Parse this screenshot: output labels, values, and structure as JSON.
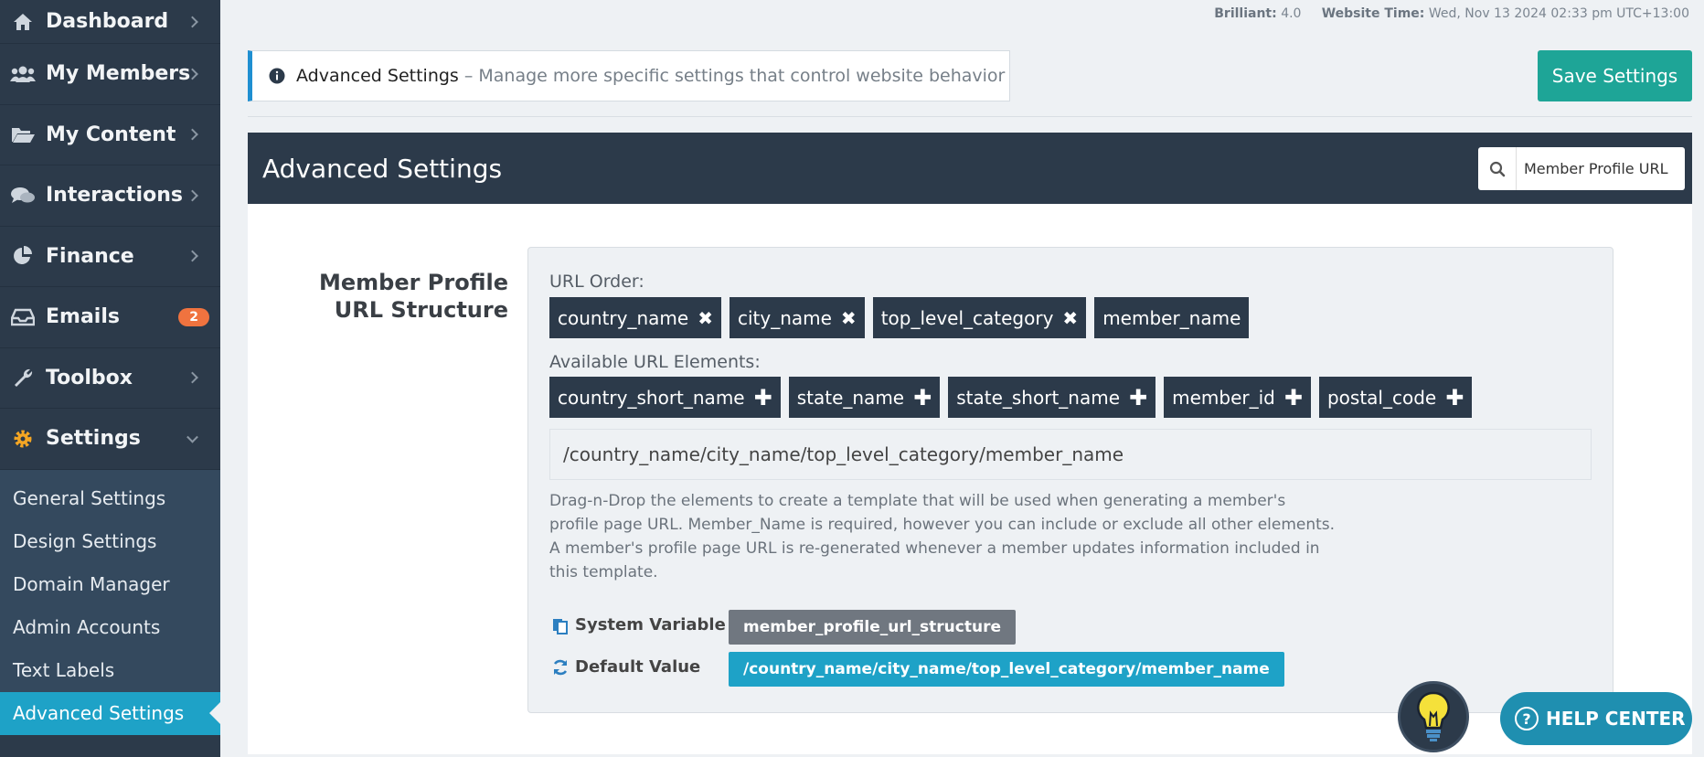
{
  "sidebar": {
    "items": [
      {
        "label": "Dashboard",
        "icon": "home-icon"
      },
      {
        "label": "My Members",
        "icon": "users-icon"
      },
      {
        "label": "My Content",
        "icon": "folder-icon"
      },
      {
        "label": "Interactions",
        "icon": "comments-icon"
      },
      {
        "label": "Finance",
        "icon": "pie-chart-icon"
      },
      {
        "label": "Emails",
        "icon": "inbox-icon",
        "badge": "2"
      },
      {
        "label": "Toolbox",
        "icon": "wrench-icon"
      },
      {
        "label": "Settings",
        "icon": "gear-icon"
      }
    ],
    "submenu": [
      "General Settings",
      "Design Settings",
      "Domain Manager",
      "Admin Accounts",
      "Text Labels",
      "Advanced Settings"
    ]
  },
  "topinfo": {
    "version_label": "Brilliant:",
    "version": "4.0",
    "time_label": "Website Time:",
    "time": "Wed, Nov 13 2024 02:33 pm UTC+13:00"
  },
  "notice": {
    "title": "Advanced Settings",
    "subtitle": "– Manage more specific settings that control website behavior"
  },
  "save_label": "Save Settings",
  "panel": {
    "title": "Advanced Settings",
    "search_value": "Member Profile URL"
  },
  "field": {
    "label": "Member Profile URL Structure",
    "url_order_label": "URL Order:",
    "url_order": [
      "country_name",
      "city_name",
      "top_level_category",
      "member_name"
    ],
    "available_label": "Available URL Elements:",
    "available": [
      "country_short_name",
      "state_name",
      "state_short_name",
      "member_id",
      "postal_code"
    ],
    "preview": "/country_name/city_name/top_level_category/member_name",
    "help": "Drag-n-Drop the elements to create a template that will be used when generating a member's profile page URL. Member_Name is required, however you can include or exclude all other elements. A member's profile page URL is re-generated whenever a member updates information included in this template.",
    "system_variable_label": "System Variable",
    "system_variable": "member_profile_url_structure",
    "default_value_label": "Default Value",
    "default_value": "/country_name/city_name/top_level_category/member_name"
  },
  "help_center_label": "HELP CENTER",
  "colors": {
    "sidebar": "#2c3a4a",
    "accent": "#1ea2c7",
    "save": "#1ea597",
    "badge": "#f0733f"
  }
}
